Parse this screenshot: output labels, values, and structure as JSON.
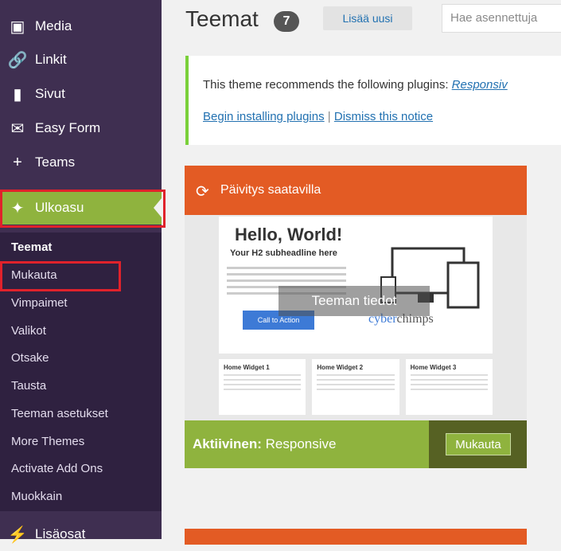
{
  "sidebar": {
    "items": [
      {
        "label": "Media",
        "icon": "media-icon"
      },
      {
        "label": "Linkit",
        "icon": "link-icon"
      },
      {
        "label": "Sivut",
        "icon": "pages-icon"
      },
      {
        "label": "Easy Form",
        "icon": "mail-icon"
      },
      {
        "label": "Teams",
        "icon": "plus-icon"
      },
      {
        "label": "Ulkoasu",
        "icon": "brush-icon"
      }
    ],
    "submenu": [
      "Teemat",
      "Mukauta",
      "Vimpaimet",
      "Valikot",
      "Otsake",
      "Tausta",
      "Teeman asetukset",
      "More Themes",
      "Activate Add Ons",
      "Muokkain"
    ],
    "bottom_item": {
      "label": "Lisäosat",
      "icon": "plugin-icon"
    }
  },
  "header": {
    "title": "Teemat",
    "count": "7",
    "add_new": "Lisää uusi",
    "search_placeholder": "Hae asennettuja"
  },
  "notice": {
    "text": "This theme recommends the following plugins:",
    "plugin_link": "Responsiv",
    "begin_link": "Begin installing plugins",
    "separator": "|",
    "dismiss_link": "Dismiss this notice"
  },
  "theme_card": {
    "update_text": "Päivitys saatavilla",
    "overlay_text": "Teeman tiedot",
    "screenshot": {
      "hello": "Hello, World!",
      "subheadline": "Your H2 subheadline here",
      "cta": "Call to Action",
      "logo_a": "cyber",
      "logo_b": "chimps",
      "widgets": [
        "Home Widget 1",
        "Home Widget 2",
        "Home Widget 3"
      ]
    },
    "active_label": "Aktiivinen:",
    "theme_name": "Responsive",
    "customize": "Mukauta"
  },
  "colors": {
    "sidebar": "#3f2f51",
    "accent_green": "#8fb33e",
    "update_orange": "#e35b24",
    "highlight_red": "#e0222b"
  }
}
